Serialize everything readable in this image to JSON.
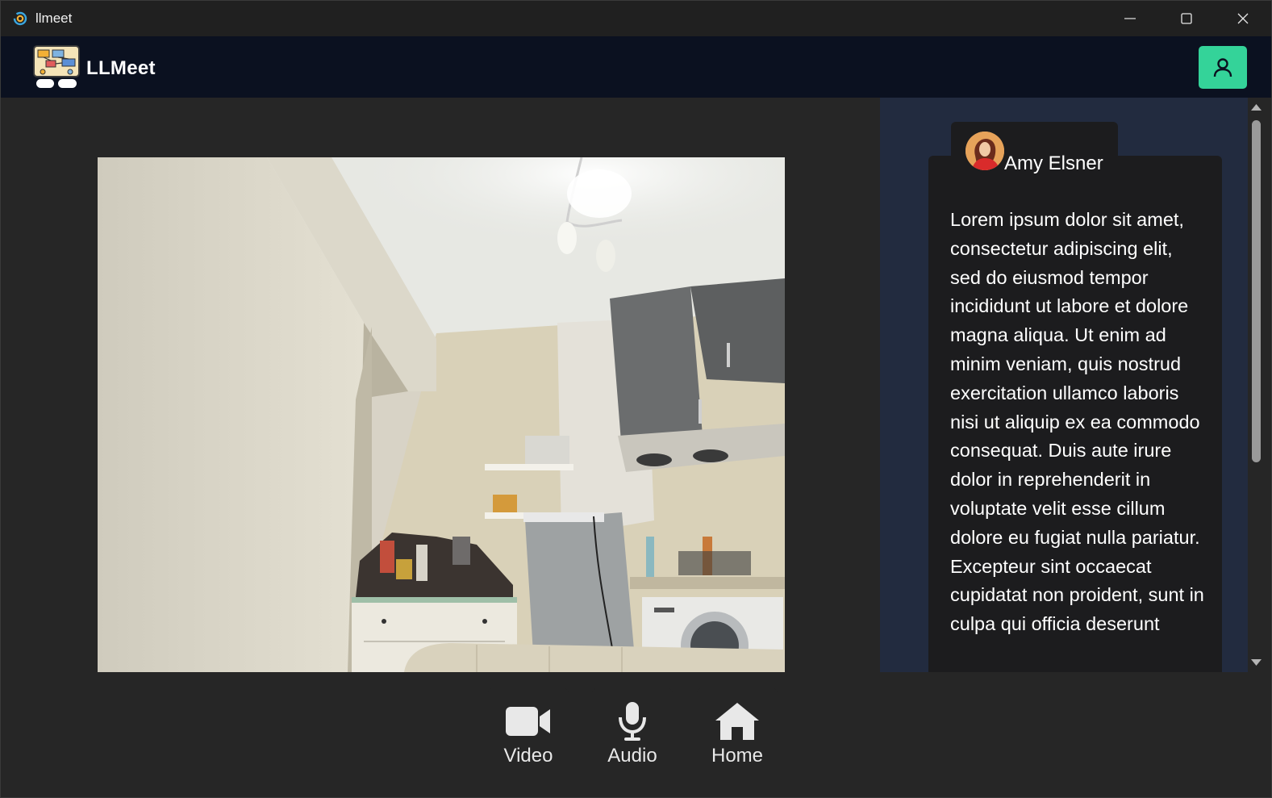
{
  "window": {
    "title": "llmeet"
  },
  "header": {
    "brand": "LLMeet"
  },
  "transcript": {
    "speaker": "Amy Elsner",
    "text": "Lorem ipsum dolor sit amet, consectetur adipiscing elit, sed do eiusmod tempor incididunt ut labore et dolore magna aliqua. Ut enim ad minim veniam, quis nostrud exercitation ullamco laboris nisi ut aliquip ex ea commodo consequat. Duis aute irure dolor in reprehenderit in voluptate velit esse cillum dolore eu fugiat nulla pariatur. Excepteur sint occaecat cupidatat non proident, sunt in culpa qui officia deserunt"
  },
  "toolbar": {
    "video_label": "Video",
    "audio_label": "Audio",
    "home_label": "Home"
  },
  "colors": {
    "header_bg": "#0b1120",
    "accent": "#34d399",
    "panel_bg": "#222b3f",
    "card_bg": "#1c1c1e"
  },
  "icons": {
    "app": "app-icon",
    "profile": "user-icon",
    "video": "video-camera-icon",
    "audio": "microphone-icon",
    "home": "home-icon"
  }
}
